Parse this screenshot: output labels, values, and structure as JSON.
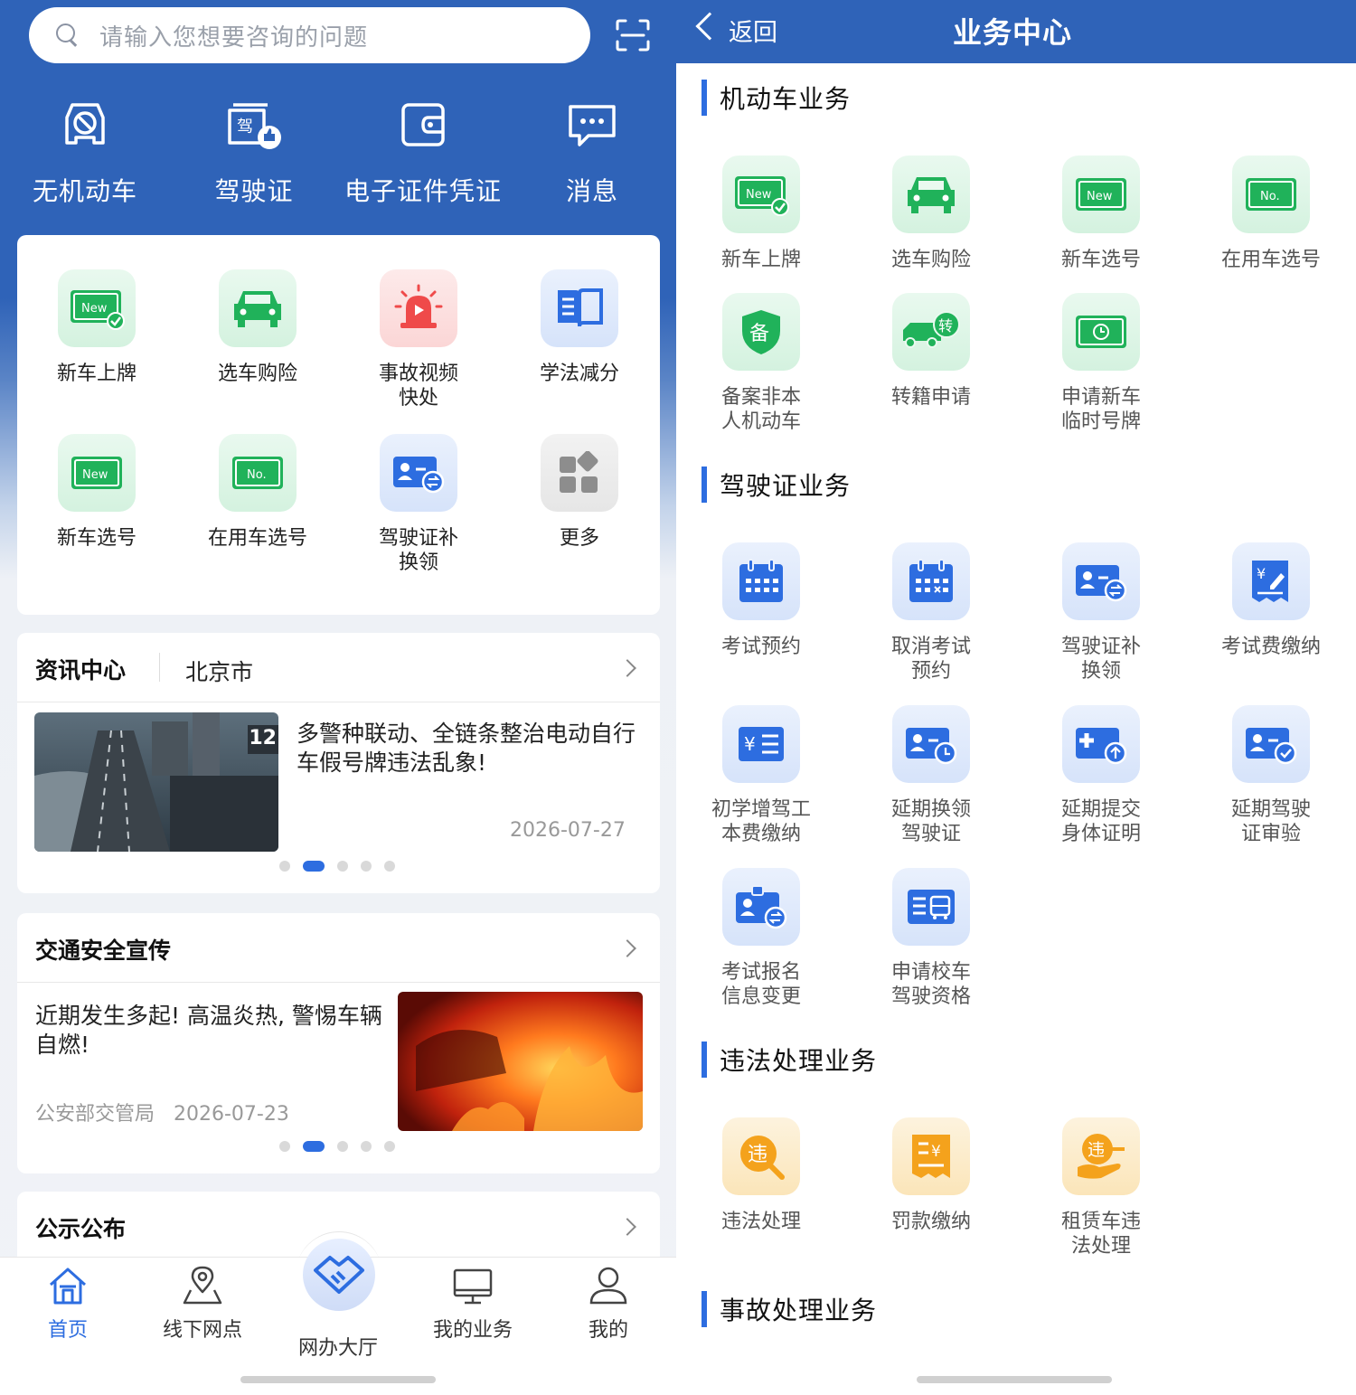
{
  "left": {
    "search": {
      "placeholder": "请输入您想要咨询的问题",
      "icon": "search-icon"
    },
    "scan_icon": "scan-icon",
    "top_nav": [
      {
        "label": "无机动车",
        "icon": "car-outline-icon"
      },
      {
        "label": "驾驶证",
        "icon": "license-icon"
      },
      {
        "label": "电子证件凭证",
        "icon": "wallet-icon"
      },
      {
        "label": "消息",
        "icon": "chat-icon"
      }
    ],
    "grid": [
      {
        "label": "新车上牌",
        "icon": "new-plate-check-icon",
        "tint": "green"
      },
      {
        "label": "选车购险",
        "icon": "car-icon",
        "tint": "green"
      },
      {
        "label": "事故视频\n快处",
        "icon": "alarm-icon",
        "tint": "red"
      },
      {
        "label": "学法减分",
        "icon": "book-icon",
        "tint": "blue"
      },
      {
        "label": "新车选号",
        "icon": "new-plate-icon",
        "tint": "green"
      },
      {
        "label": "在用车选号",
        "icon": "no-plate-icon",
        "tint": "green"
      },
      {
        "label": "驾驶证补\n换领",
        "icon": "license-swap-icon",
        "tint": "blue"
      },
      {
        "label": "更多",
        "icon": "more-apps-icon",
        "tint": "gray"
      }
    ],
    "news": {
      "title": "资讯中心",
      "city": "北京市",
      "headline": "多警种联动、全链条整治电动自行车假号牌违法乱象!",
      "date": "2026-07-27",
      "image_text": "12"
    },
    "safety": {
      "title": "交通安全宣传",
      "headline": "近期发生多起! 高温炎热, 警惕车辆自燃!",
      "source": "公安部交管局",
      "date": "2026-07-23"
    },
    "notice": {
      "title": "公示公布"
    },
    "tabs": [
      {
        "label": "首页",
        "icon": "home-icon",
        "active": true
      },
      {
        "label": "线下网点",
        "icon": "map-pin-icon",
        "active": false
      },
      {
        "label": "网办大厅",
        "icon": "handshake-icon",
        "active": false
      },
      {
        "label": "我的业务",
        "icon": "monitor-icon",
        "active": false
      },
      {
        "label": "我的",
        "icon": "user-icon",
        "active": false
      }
    ]
  },
  "right": {
    "back_label": "返回",
    "title": "业务中心",
    "sections": [
      {
        "title": "机动车业务",
        "items": [
          {
            "label": "新车上牌",
            "icon": "new-plate-check-icon"
          },
          {
            "label": "选车购险",
            "icon": "car-icon"
          },
          {
            "label": "新车选号",
            "icon": "new-plate-icon"
          },
          {
            "label": "在用车选号",
            "icon": "no-plate-icon"
          },
          {
            "label": "备案非本\n人机动车",
            "icon": "shield-record-icon"
          },
          {
            "label": "转籍申请",
            "icon": "truck-transfer-icon"
          },
          {
            "label": "申请新车\n临时号牌",
            "icon": "temp-plate-icon"
          }
        ]
      },
      {
        "title": "驾驶证业务",
        "items": [
          {
            "label": "考试预约",
            "icon": "calendar-icon"
          },
          {
            "label": "取消考试\n预约",
            "icon": "calendar-cancel-icon"
          },
          {
            "label": "驾驶证补\n换领",
            "icon": "license-swap-icon"
          },
          {
            "label": "考试费缴纳",
            "icon": "fee-receipt-icon"
          },
          {
            "label": "初学增驾工\n本费缴纳",
            "icon": "fee-list-icon"
          },
          {
            "label": "延期换领\n驾驶证",
            "icon": "license-clock-icon"
          },
          {
            "label": "延期提交\n身体证明",
            "icon": "medical-upload-icon"
          },
          {
            "label": "延期驾驶\n证审验",
            "icon": "license-check-icon"
          },
          {
            "label": "考试报名\n信息变更",
            "icon": "exam-info-swap-icon"
          },
          {
            "label": "申请校车\n驾驶资格",
            "icon": "school-bus-icon"
          }
        ]
      },
      {
        "title": "违法处理业务",
        "items": [
          {
            "label": "违法处理",
            "icon": "violation-search-icon"
          },
          {
            "label": "罚款缴纳",
            "icon": "fine-receipt-icon"
          },
          {
            "label": "租赁车违\n法处理",
            "icon": "rental-violation-icon"
          }
        ]
      },
      {
        "title": "事故处理业务",
        "items": []
      }
    ]
  },
  "colors": {
    "brand_blue": "#2f63b8",
    "accent_blue": "#2d6de0",
    "icon_green": "#20b25a",
    "icon_red": "#ef4a4a",
    "icon_orange": "#f4a21c"
  }
}
